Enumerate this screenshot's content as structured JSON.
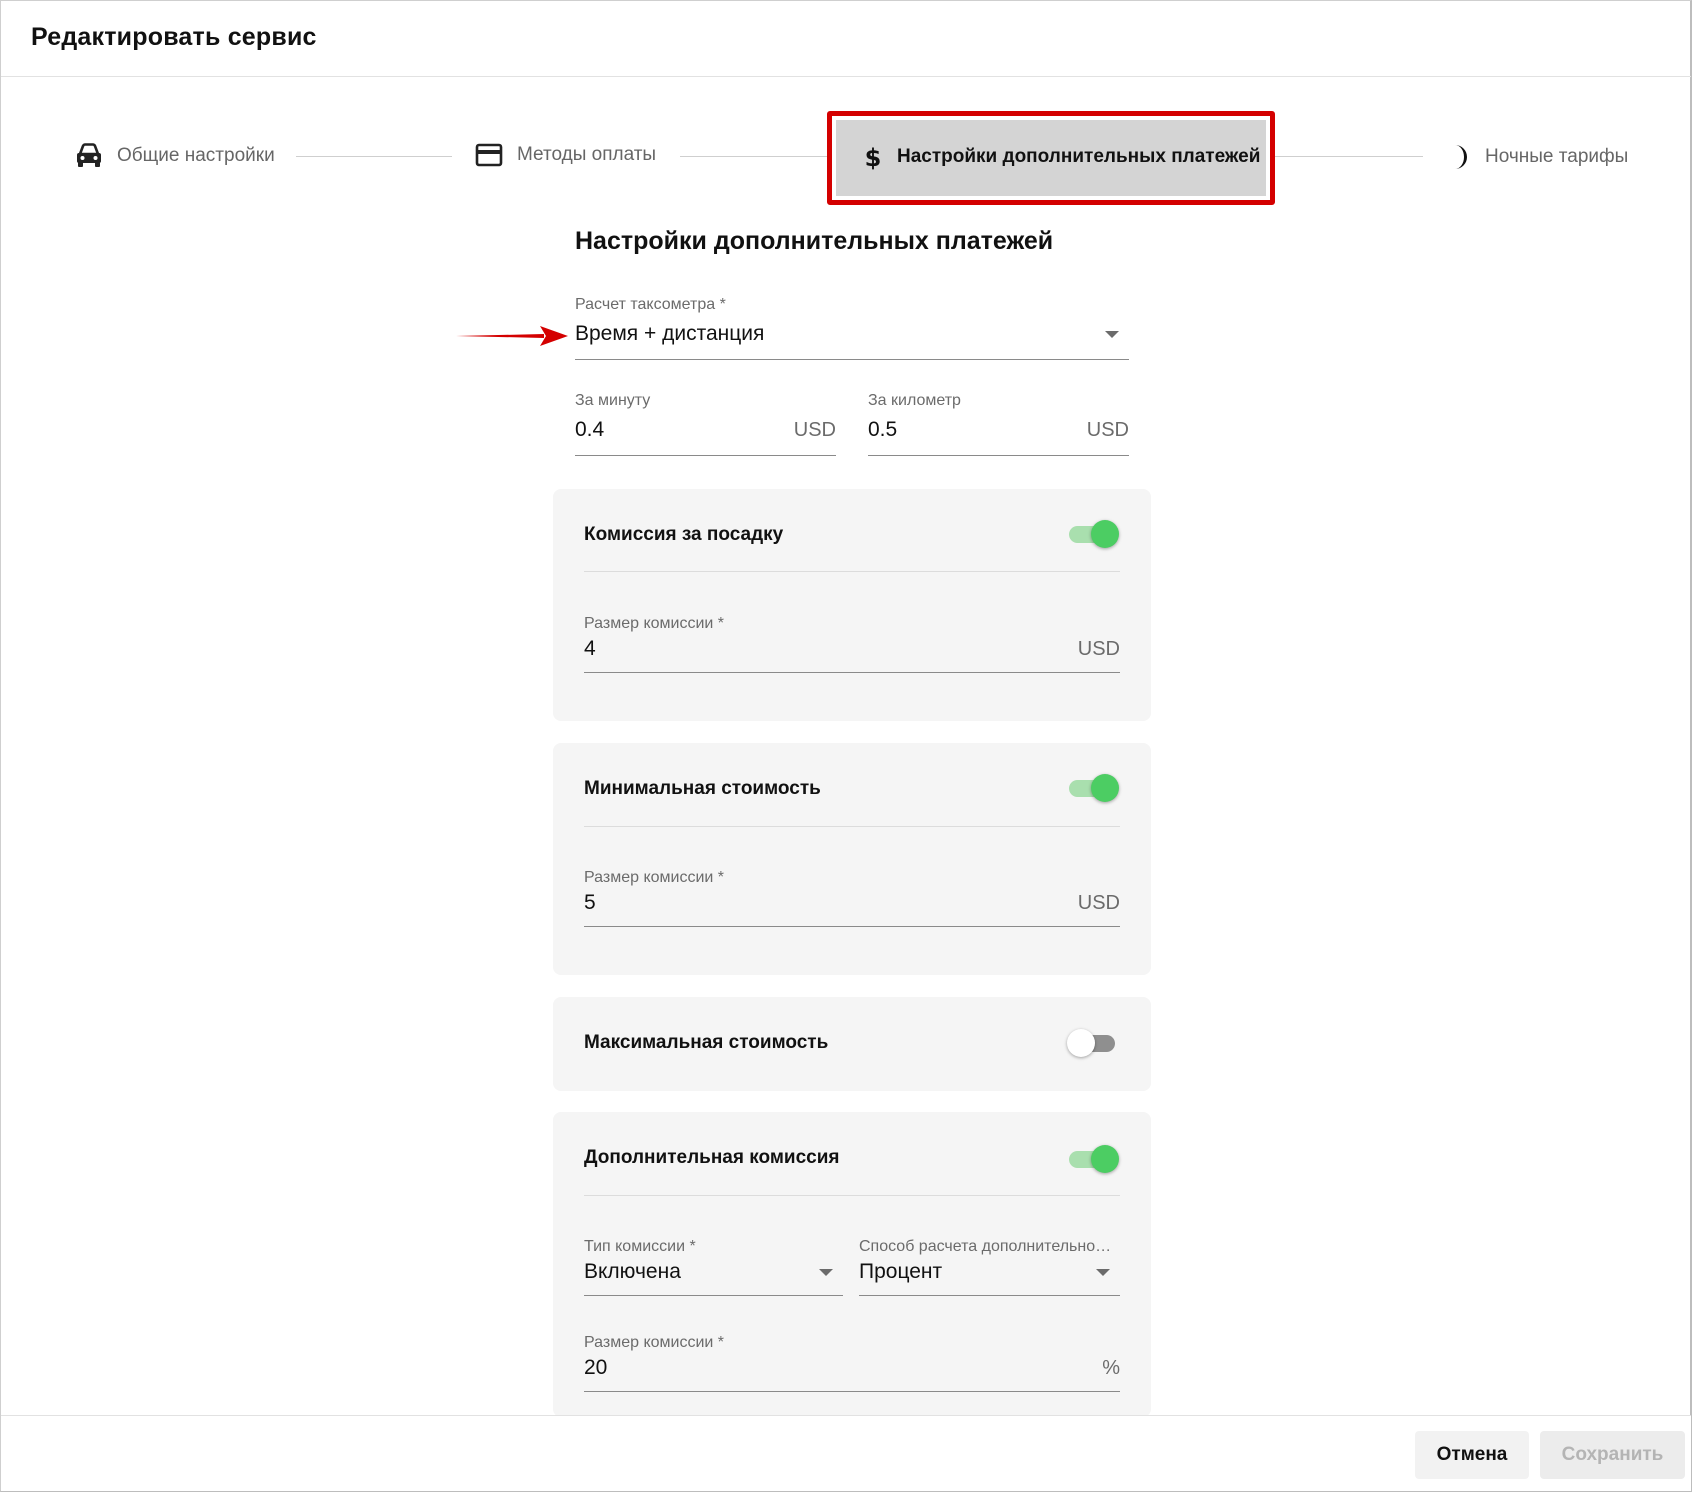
{
  "dialog": {
    "title": "Редактировать сервис"
  },
  "stepper": {
    "steps": [
      {
        "label": "Общие настройки",
        "icon": "car-icon",
        "active": false
      },
      {
        "label": "Методы оплаты",
        "icon": "credit-card-icon",
        "active": false
      },
      {
        "label": "Настройки дополнительных платежей",
        "icon": "dollar-icon",
        "active": true
      },
      {
        "label": "Ночные тарифы",
        "icon": "moon-icon",
        "active": false
      }
    ]
  },
  "form": {
    "section_title": "Настройки дополнительных платежей",
    "taximeter": {
      "label": "Расчет таксометра *",
      "value": "Время + дистанция"
    },
    "per_minute": {
      "label": "За минуту",
      "value": "0.4",
      "suffix": "USD"
    },
    "per_km": {
      "label": "За километр",
      "value": "0.5",
      "suffix": "USD"
    },
    "boarding_fee": {
      "title": "Комиссия за посадку",
      "enabled": true,
      "amount": {
        "label": "Размер комиссии *",
        "value": "4",
        "suffix": "USD"
      }
    },
    "min_cost": {
      "title": "Минимальная стоимость",
      "enabled": true,
      "amount": {
        "label": "Размер комиссии *",
        "value": "5",
        "suffix": "USD"
      }
    },
    "max_cost": {
      "title": "Максимальная стоимость",
      "enabled": false
    },
    "extra_fee": {
      "title": "Дополнительная комиссия",
      "enabled": true,
      "type": {
        "label": "Тип комиссии *",
        "value": "Включена"
      },
      "method": {
        "label": "Способ расчета дополнительно…",
        "value": "Процент"
      },
      "amount": {
        "label": "Размер комиссии *",
        "value": "20",
        "suffix": "%"
      }
    }
  },
  "footer": {
    "cancel_label": "Отмена",
    "save_label": "Сохранить"
  },
  "colors": {
    "accent_green": "#4ccd63",
    "highlight_red": "#d40000"
  }
}
